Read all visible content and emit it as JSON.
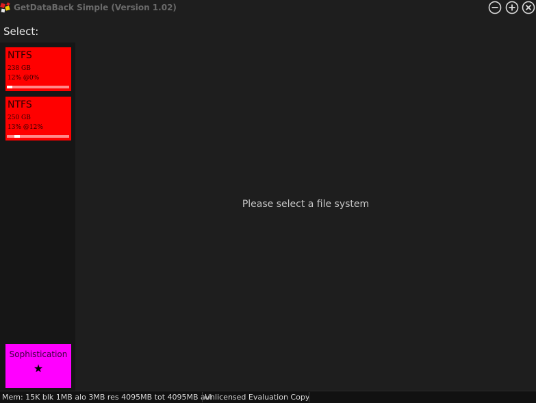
{
  "window": {
    "title": "GetDataBack Simple (Version 1.02)"
  },
  "select_label": "Select:",
  "file_systems": [
    {
      "type": "NTFS",
      "size": "238 GB",
      "status": "12% @0%",
      "progress": 0.12,
      "progress_start": 0.0
    },
    {
      "type": "NTFS",
      "size": "250 GB",
      "status": "13% @12%",
      "progress": 0.13,
      "progress_start": 0.12
    }
  ],
  "sophistication": {
    "label": "Sophistication",
    "star": "★"
  },
  "main_message": "Please select a file system",
  "statusbar": {
    "memory": "Mem: 15K blk 1MB alo 3MB res 4095MB tot 4095MB avl",
    "license": "Unlicensed Evaluation Copy"
  },
  "colors": {
    "tile_fs": "#ff0000",
    "tile_sophistication": "#ff00ff",
    "background": "#1e1e1e",
    "panel": "#161616"
  },
  "icons": {
    "app": "getdataback-app-icon",
    "minimize": "minimize-icon",
    "maximize": "maximize-icon",
    "close": "close-icon"
  }
}
